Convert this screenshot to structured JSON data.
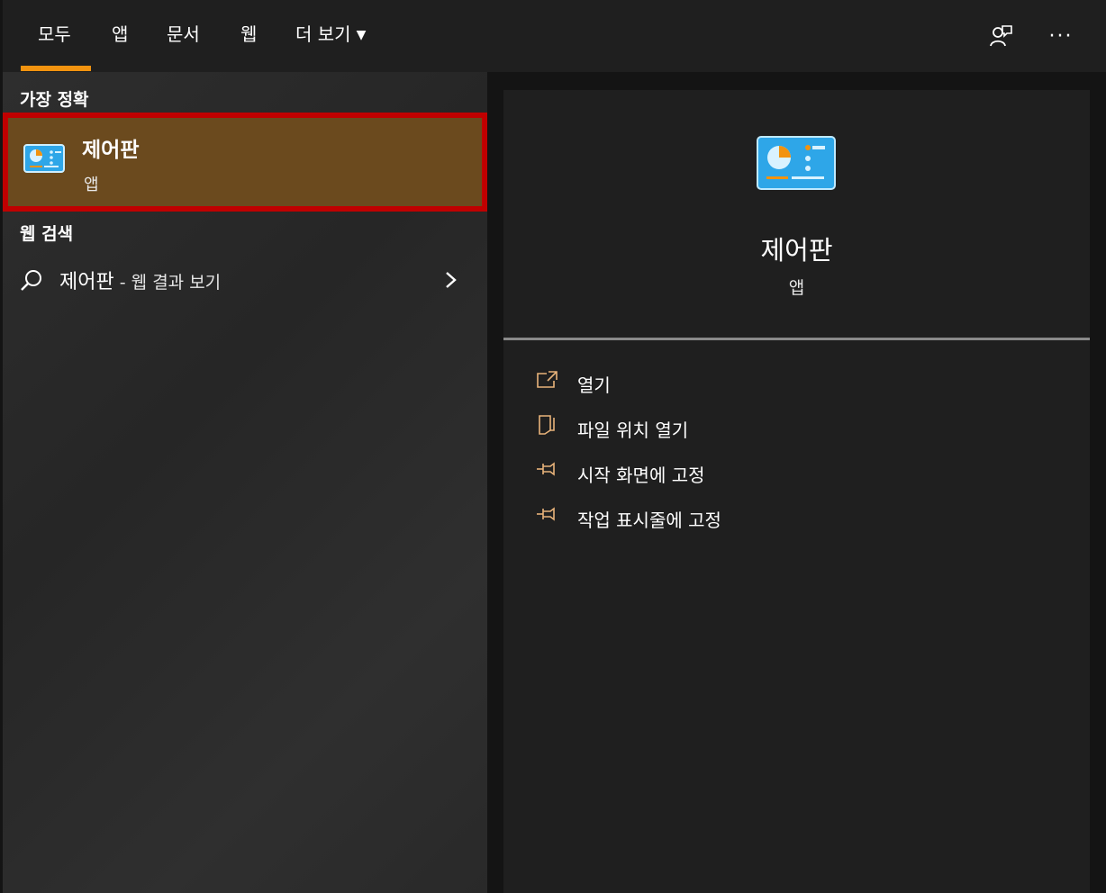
{
  "tabs": [
    {
      "label": "모두"
    },
    {
      "label": "앱"
    },
    {
      "label": "문서"
    },
    {
      "label": "웹"
    },
    {
      "label": "더 보기"
    }
  ],
  "top_icons": [
    "feedback-icon",
    "more-options-icon"
  ],
  "more_glyph": "···",
  "left": {
    "best_match_heading": "가장 정확",
    "best_match": {
      "title": "제어판",
      "subtitle": "앱",
      "icon": "control-panel-icon"
    },
    "web_heading": "웹 검색",
    "web_result": {
      "query": "제어판",
      "suffix": " - 웹 결과 보기",
      "icon": "search-icon"
    }
  },
  "detail": {
    "title": "제어판",
    "subtitle": "앱",
    "icon": "control-panel-icon",
    "actions": [
      {
        "label": "열기",
        "icon": "open-icon"
      },
      {
        "label": "파일 위치 열기",
        "icon": "file-location-icon"
      },
      {
        "label": "시작 화면에 고정",
        "icon": "pin-icon"
      },
      {
        "label": "작업 표시줄에 고정",
        "icon": "pin-icon"
      }
    ]
  },
  "colors": {
    "accent": "#f2930f",
    "highlight_border": "#c00000",
    "selected_bg": "#6b4a1e",
    "action_icon": "#e8b37a"
  }
}
